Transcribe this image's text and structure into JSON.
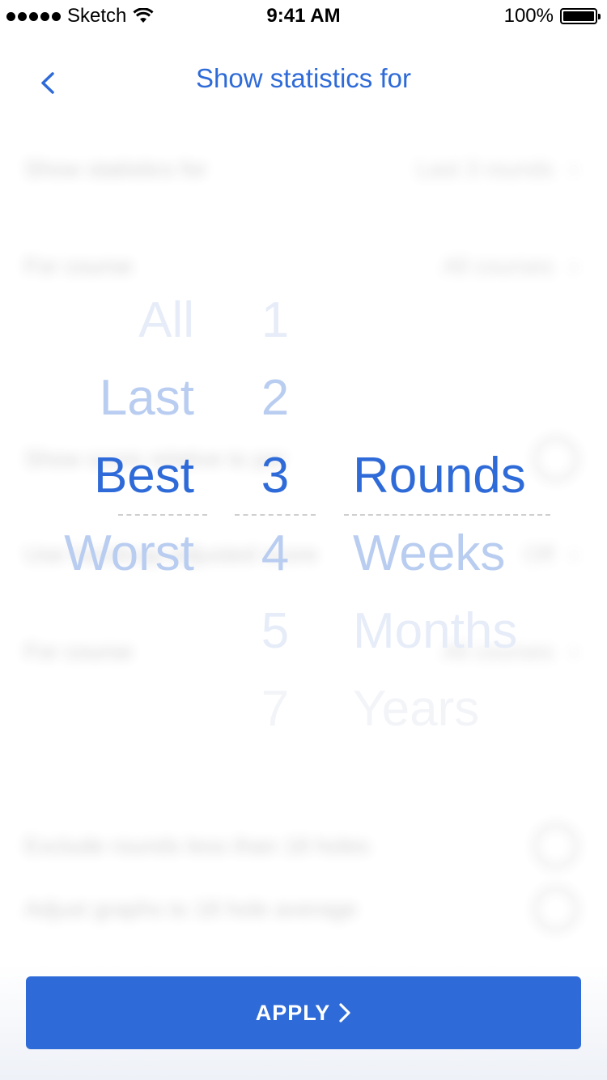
{
  "status_bar": {
    "carrier": "Sketch",
    "time": "9:41 AM",
    "battery": "100%"
  },
  "header": {
    "title": "Show statistics for",
    "back_icon": "chevron-left-icon"
  },
  "background_settings": [
    {
      "label": "Show statistics for",
      "value": "Last 3 rounds"
    },
    {
      "label": "For course",
      "value": "All courses"
    },
    {
      "label": "Show score relative to par",
      "value": ""
    },
    {
      "label": "Use handicap-adjusted score",
      "value": "Off"
    },
    {
      "label": "For course",
      "value": "All courses"
    },
    {
      "label": "Exclude rounds less than 18 holes",
      "value": ""
    },
    {
      "label": "Adjust graphs to 18 hole average",
      "value": ""
    }
  ],
  "picker": {
    "column1": [
      "All",
      "Last",
      "Best",
      "Worst"
    ],
    "column2": [
      "1",
      "2",
      "3",
      "4",
      "5",
      "7"
    ],
    "column3": [
      "Rounds",
      "Weeks",
      "Months",
      "Years"
    ],
    "selected": {
      "column1": "Best",
      "column2": "3",
      "column3": "Rounds"
    }
  },
  "apply": {
    "label": "APPLY",
    "icon": "chevron-right-icon"
  },
  "colors": {
    "accent": "#2f6bd8",
    "faded": "#b9cdf1"
  }
}
